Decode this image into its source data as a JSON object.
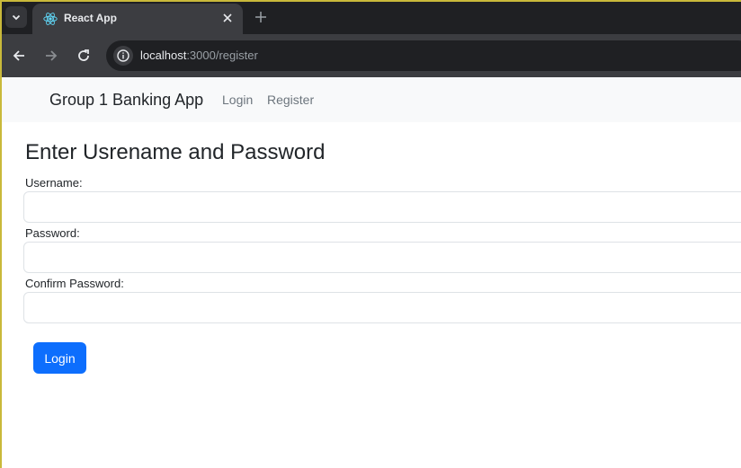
{
  "browser": {
    "tab": {
      "title": "React App",
      "favicon": "react-logo-icon"
    },
    "address": {
      "host": "localhost",
      "path": ":3000/register"
    },
    "colors": {
      "tabstrip": "#1f2023",
      "toolbar": "#3c3d41"
    }
  },
  "navbar": {
    "brand": "Group 1 Banking App",
    "links": [
      "Login",
      "Register"
    ]
  },
  "form": {
    "heading": "Enter Usrename and Password",
    "fields": [
      {
        "label": "Username:",
        "value": ""
      },
      {
        "label": "Password:",
        "value": ""
      },
      {
        "label": "Confirm Password:",
        "value": ""
      }
    ],
    "submit_label": "Login"
  },
  "colors": {
    "primary": "#0d6efd",
    "navbar_bg": "#f8f9fa"
  }
}
